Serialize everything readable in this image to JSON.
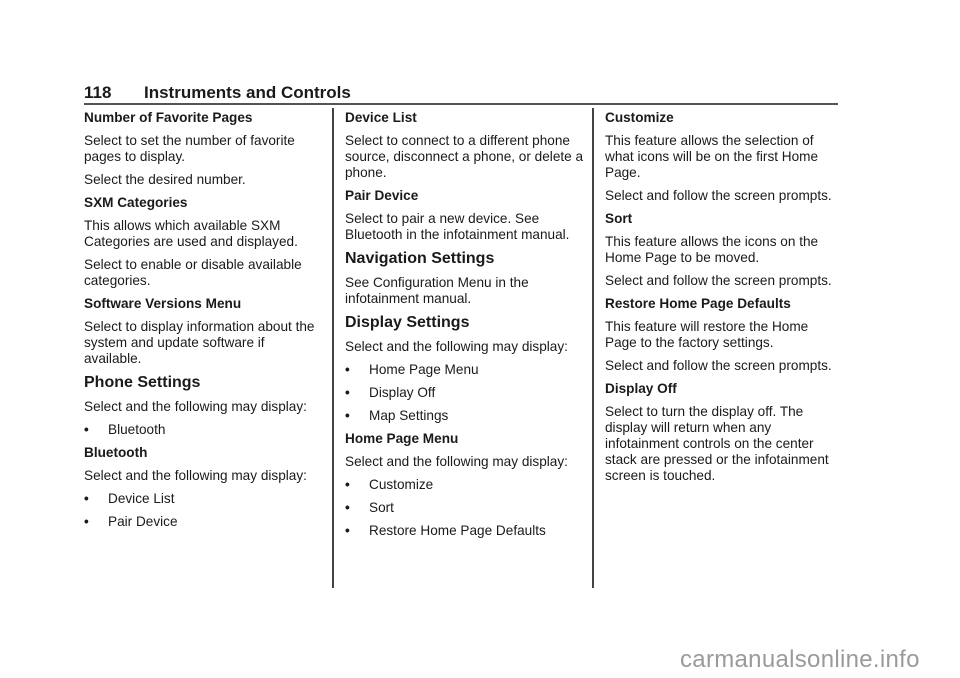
{
  "header": {
    "page_number": "118",
    "section_title": "Instruments and Controls"
  },
  "columns": [
    {
      "blocks": [
        {
          "type": "h3",
          "text": "Number of Favorite Pages"
        },
        {
          "type": "p",
          "text": "Select to set the number of favorite pages to display."
        },
        {
          "type": "p",
          "text": "Select the desired number."
        },
        {
          "type": "h3",
          "text": "SXM Categories"
        },
        {
          "type": "p",
          "text": "This allows which available SXM Categories are used and displayed."
        },
        {
          "type": "p",
          "text": "Select to enable or disable available categories."
        },
        {
          "type": "h3",
          "text": "Software Versions Menu"
        },
        {
          "type": "p",
          "text": "Select to display information about the system and update software if available."
        },
        {
          "type": "h2",
          "text": "Phone Settings"
        },
        {
          "type": "p",
          "text": "Select and the following may display:"
        },
        {
          "type": "li",
          "text": "Bluetooth"
        },
        {
          "type": "h3",
          "text": "Bluetooth"
        },
        {
          "type": "p",
          "text": "Select and the following may display:"
        },
        {
          "type": "li",
          "text": "Device List"
        },
        {
          "type": "li",
          "text": "Pair Device"
        }
      ]
    },
    {
      "blocks": [
        {
          "type": "h3",
          "text": "Device List"
        },
        {
          "type": "p",
          "text": "Select to connect to a different phone source, disconnect a phone, or delete a phone."
        },
        {
          "type": "h3",
          "text": "Pair Device"
        },
        {
          "type": "p",
          "text": "Select to pair a new device. See  Bluetooth  in the infotainment manual."
        },
        {
          "type": "h2",
          "text": "Navigation Settings"
        },
        {
          "type": "p",
          "text": "See  Configuration Menu  in the infotainment manual."
        },
        {
          "type": "h2",
          "text": "Display Settings"
        },
        {
          "type": "p",
          "text": "Select and the following may display:"
        },
        {
          "type": "li",
          "text": "Home Page Menu"
        },
        {
          "type": "li",
          "text": "Display Off"
        },
        {
          "type": "li",
          "text": "Map Settings"
        },
        {
          "type": "h3",
          "text": "Home Page Menu"
        },
        {
          "type": "p",
          "text": "Select and the following may display:"
        },
        {
          "type": "li",
          "text": "Customize"
        },
        {
          "type": "li",
          "text": "Sort"
        },
        {
          "type": "li",
          "text": "Restore Home Page Defaults"
        }
      ]
    },
    {
      "blocks": [
        {
          "type": "h3",
          "text": "Customize"
        },
        {
          "type": "p",
          "text": "This feature allows the selection of what icons will be on the first Home Page."
        },
        {
          "type": "p",
          "text": "Select and follow the screen prompts."
        },
        {
          "type": "h3",
          "text": "Sort"
        },
        {
          "type": "p",
          "text": "This feature allows the icons on the Home Page to be moved."
        },
        {
          "type": "p",
          "text": "Select and follow the screen prompts."
        },
        {
          "type": "h3",
          "text": "Restore Home Page Defaults"
        },
        {
          "type": "p",
          "text": "This feature will restore the Home Page to the factory settings."
        },
        {
          "type": "p",
          "text": "Select and follow the screen prompts."
        },
        {
          "type": "h3",
          "text": "Display Off"
        },
        {
          "type": "p",
          "text": "Select to turn the display off. The display will return when any infotainment controls on the center stack are pressed or the infotainment screen is touched."
        }
      ]
    }
  ],
  "bullet_glyph": "•",
  "watermark": "carmanualsonline.info"
}
